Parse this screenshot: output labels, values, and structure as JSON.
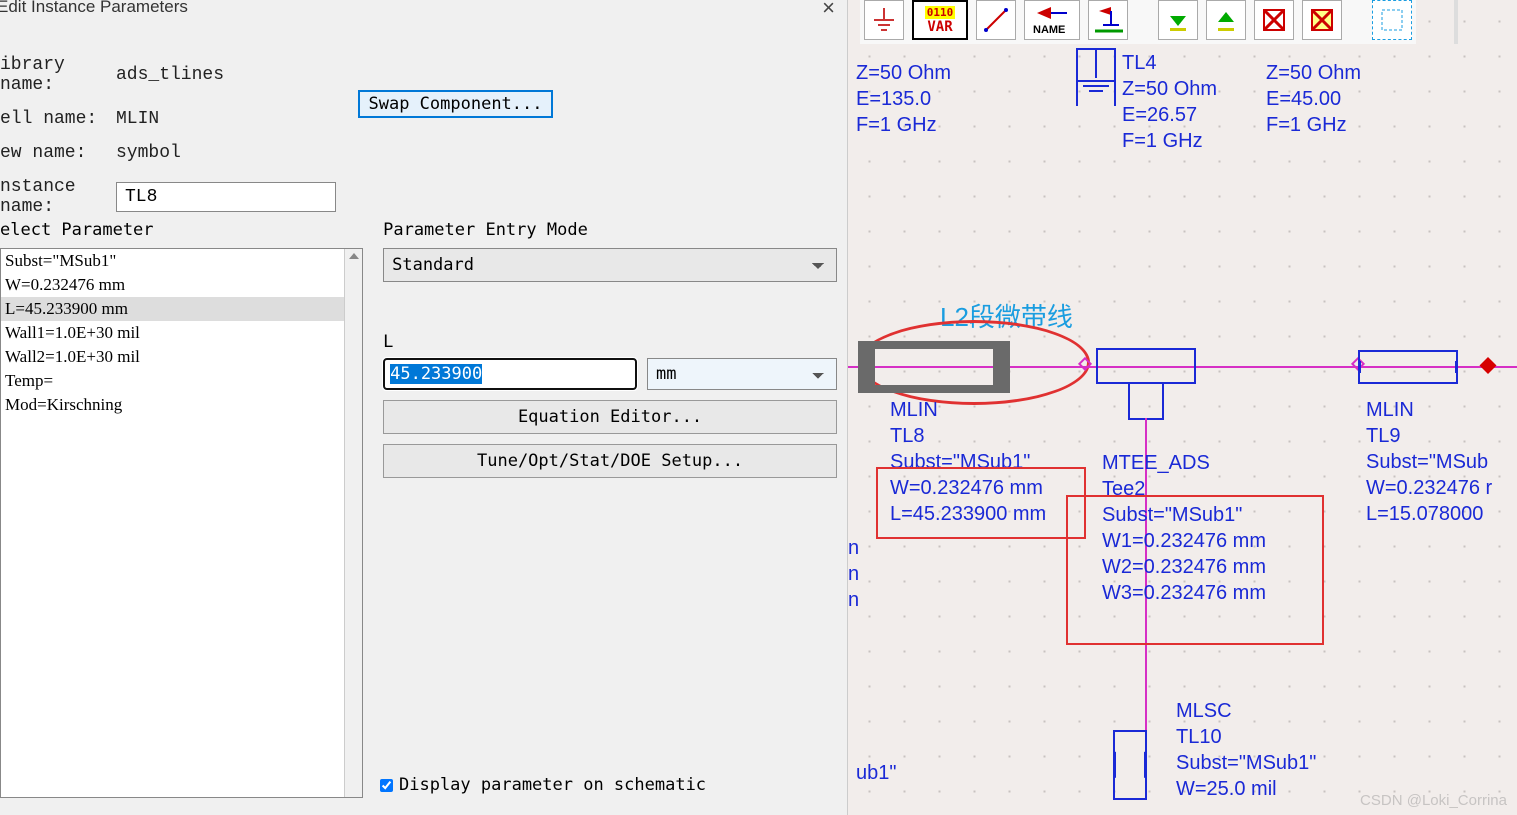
{
  "dialog": {
    "title": "Edit Instance Parameters",
    "lib_label": "ibrary name:",
    "lib_value": "ads_tlines",
    "cell_label": "ell name:",
    "cell_value": "MLIN",
    "view_label": "ew name:",
    "view_value": "symbol",
    "inst_label": "nstance name:",
    "inst_value": "TL8",
    "swap_label": "Swap Component...",
    "select_param_label": "elect Parameter",
    "entry_mode_label": "Parameter Entry Mode",
    "entry_mode_value": "Standard",
    "params": [
      "Subst=\"MSub1\"",
      "W=0.232476 mm",
      "L=45.233900 mm",
      "Wall1=1.0E+30 mil",
      "Wall2=1.0E+30 mil",
      "Temp=",
      "Mod=Kirschning"
    ],
    "selected_param_index": 2,
    "field_label": "L",
    "field_value": "45.233900",
    "unit_value": "mm",
    "eq_btn": "Equation Editor...",
    "tune_btn": "Tune/Opt/Stat/DOE Setup...",
    "disp_label": "Display parameter on schematic",
    "disp_checked": true
  },
  "toolbar": {
    "icons": [
      "ground-icon",
      "var-icon",
      "wire-icon",
      "name-port-icon",
      "name-net-icon",
      "sep",
      "down-green-icon",
      "up-green-icon",
      "deactivate-x-icon",
      "short-x-icon",
      "sep",
      "select-icon"
    ]
  },
  "schematic": {
    "top_left": {
      "lines": [
        "Z=50 Ohm",
        "E=135.0",
        "F=1 GHz"
      ]
    },
    "tl4": {
      "name": "TL4",
      "lines": [
        "Z=50 Ohm",
        "E=26.57",
        "F=1 GHz"
      ]
    },
    "tl_top_right": {
      "lines": [
        "Z=50 Ohm",
        "E=45.00",
        "F=1 GHz"
      ]
    },
    "cn_label": "L2段微带线",
    "tl8": {
      "type": "MLIN",
      "name": "TL8",
      "lines": [
        "Subst=\"MSub1\"",
        "W=0.232476 mm",
        "L=45.233900 mm"
      ]
    },
    "tee2": {
      "type": "MTEE_ADS",
      "name": "Tee2",
      "lines": [
        "Subst=\"MSub1\"",
        "W1=0.232476 mm",
        "W2=0.232476 mm",
        "W3=0.232476 mm"
      ]
    },
    "tl9": {
      "type": "MLIN",
      "name": "TL9",
      "lines": [
        "Subst=\"MSub",
        "W=0.232476 r",
        "L=15.078000"
      ]
    },
    "tl10": {
      "type": "MLSC",
      "name": "TL10",
      "lines": [
        "Subst=\"MSub1\"",
        "W=25.0 mil"
      ]
    },
    "left_frag": "ub1\"",
    "n_chars": [
      "n",
      "n",
      "n"
    ],
    "watermark": "CSDN @Loki_Corrina"
  }
}
